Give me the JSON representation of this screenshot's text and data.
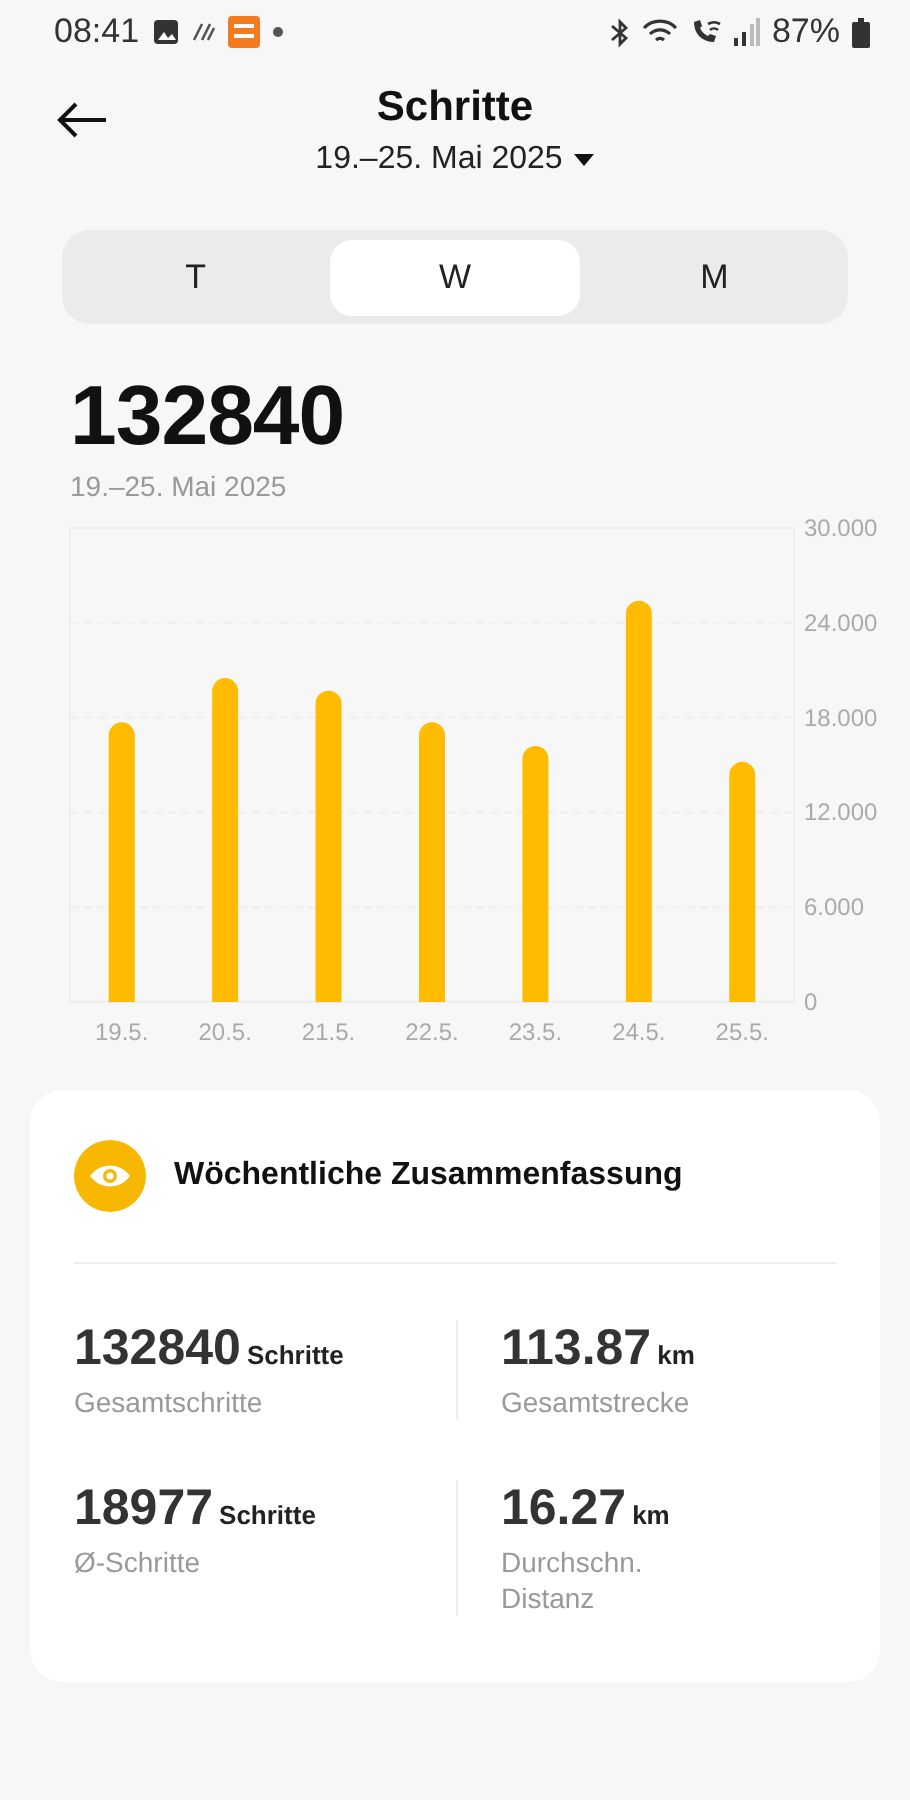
{
  "status_bar": {
    "time": "08:41",
    "battery_text": "87%"
  },
  "header": {
    "title": "Schritte",
    "date_range": "19.–25. Mai 2025"
  },
  "tabs": [
    {
      "label": "T",
      "selected": false
    },
    {
      "label": "W",
      "selected": true
    },
    {
      "label": "M",
      "selected": false
    }
  ],
  "summary": {
    "total": "132840",
    "range": "19.–25. Mai 2025"
  },
  "chart": {
    "chart_data": {
      "type": "bar",
      "categories": [
        "19.5.",
        "20.5.",
        "21.5.",
        "22.5.",
        "23.5.",
        "24.5.",
        "25.5."
      ],
      "series": [
        {
          "color": "#ffbb00",
          "values": [
            17.7,
            20.5,
            19.7,
            17.7,
            16.2,
            25.4,
            15.2
          ]
        }
      ],
      "ylim": [
        0,
        30
      ],
      "grid": true,
      "yticks": [
        {
          "value": 0,
          "label": "0"
        },
        {
          "value": 6,
          "label": "6.000"
        },
        {
          "value": 12,
          "label": "12.000"
        },
        {
          "value": 18,
          "label": "18.000"
        },
        {
          "value": 24,
          "label": "24.000"
        },
        {
          "value": 30,
          "label": "30.000"
        }
      ]
    }
  },
  "weekly_card": {
    "title": "Wöchentliche Zusammenfassung",
    "stats": [
      {
        "value": "132840",
        "unit": "Schritte",
        "label": "Gesamtschritte"
      },
      {
        "value": "113.87",
        "unit": "km",
        "label": "Gesamtstrecke"
      },
      {
        "value": "18977",
        "unit": "Schritte",
        "label": "Ø-Schritte"
      },
      {
        "value": "16.27",
        "unit": "km",
        "label": "Durchschn. Distanz"
      }
    ]
  }
}
